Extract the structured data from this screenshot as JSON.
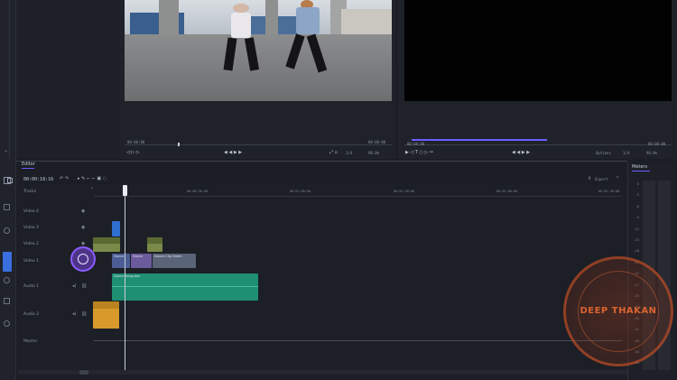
{
  "source_monitor": {
    "timecode_left": "00:00:00",
    "timecode_right": "00:00:00",
    "fraction": "1/4",
    "zoom": "90.0%"
  },
  "program_monitor": {
    "timecode_left": "00:00:00",
    "timecode_right": "00:00:00",
    "options_label": "Options",
    "fraction": "1/4",
    "zoom": "90.0%"
  },
  "editor": {
    "tab_label": "Editor",
    "timecode": "00:00:18:16",
    "export_label": "Export",
    "tracks_label": "Tracks",
    "ruler_ticks": [
      "00:00:30:00",
      "00:01:00:00",
      "00:01:30:00",
      "00:02:00:00",
      "00:02:30:00"
    ]
  },
  "tracks": [
    {
      "label": "Video 4"
    },
    {
      "label": "Video 3"
    },
    {
      "label": "Video 2"
    },
    {
      "label": "Video 1"
    },
    {
      "label": "Audio 1"
    },
    {
      "label": "Audio 2"
    },
    {
      "label": "Master"
    }
  ],
  "clips": {
    "video1_a": "Dance",
    "video1_b": "Dance",
    "video1_c": "Dance Clip Green",
    "audio1": "Dance Song.wav"
  },
  "meters": {
    "tab_label": "Meters",
    "scale": [
      "0",
      "-3",
      "-6",
      "-9",
      "-12",
      "-15",
      "-18",
      "-21",
      "-24",
      "-27",
      "-30",
      "-33",
      "-36",
      "-42",
      "-48",
      "-54",
      "-60"
    ]
  },
  "watermark": {
    "text": "DEEP THAKAN"
  },
  "colors": {
    "accent": "#6a5cff",
    "audio_clip": "#1f8f74",
    "audio2_clip": "#d79a2b",
    "video3_clip": "#2f6fd0",
    "video2_clip": "#7a8a48"
  }
}
